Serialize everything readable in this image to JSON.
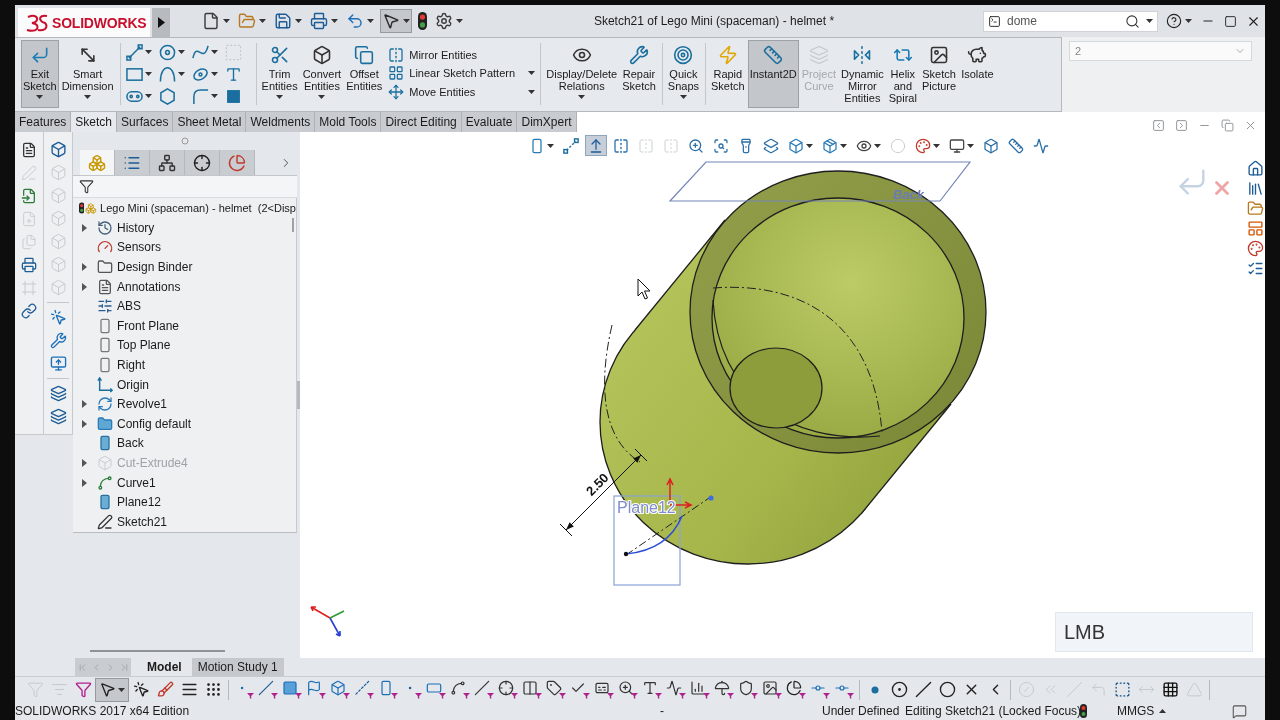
{
  "window": {
    "logo": "SOLIDWORKS",
    "title": "Sketch21 of Lego Mini (spaceman) - helmet *"
  },
  "quick_access": [
    {
      "kind": "new",
      "selected": false,
      "dropdown": true
    },
    {
      "kind": "open",
      "selected": false,
      "dropdown": true
    },
    {
      "kind": "save",
      "selected": false,
      "dropdown": true
    },
    {
      "kind": "print",
      "selected": false,
      "dropdown": true
    },
    {
      "kind": "undo",
      "selected": false,
      "dropdown": true
    },
    {
      "kind": "select",
      "selected": true,
      "dropdown": true
    },
    {
      "kind": "rebuild",
      "selected": false,
      "dropdown": false
    },
    {
      "kind": "options",
      "selected": false,
      "dropdown": true
    }
  ],
  "search": {
    "value": "dome"
  },
  "configuration": {
    "value": "2"
  },
  "command_groups": [
    {
      "items": [
        {
          "kind": "exitsketch",
          "label": "Exit Sketch",
          "selected": true,
          "disabled": false,
          "dropdown": true
        },
        {
          "kind": "dimension",
          "label": "Smart Dimension",
          "selected": false,
          "disabled": false,
          "dropdown": true
        }
      ]
    },
    {
      "items": [
        {
          "kind": "grid",
          "tools": [
            {
              "kind": "line",
              "dropdown": true,
              "disabled": false
            },
            {
              "kind": "circle",
              "dropdown": true,
              "disabled": false
            },
            {
              "kind": "spline",
              "dropdown": true,
              "disabled": false
            },
            {
              "kind": "construction",
              "dropdown": false,
              "disabled": true
            },
            {
              "kind": "rectangle",
              "dropdown": true,
              "disabled": false
            },
            {
              "kind": "arc",
              "dropdown": true,
              "disabled": false
            },
            {
              "kind": "ellipse",
              "dropdown": true,
              "disabled": false
            },
            {
              "kind": "text",
              "dropdown": false,
              "disabled": false
            },
            {
              "kind": "slot",
              "dropdown": true,
              "disabled": false
            },
            {
              "kind": "polygon",
              "dropdown": false,
              "disabled": false
            },
            {
              "kind": "fillet",
              "dropdown": true,
              "disabled": false
            },
            {
              "kind": "point",
              "dropdown": false,
              "disabled": false
            }
          ]
        }
      ]
    },
    {
      "items": [
        {
          "kind": "trim",
          "label": "Trim Entities",
          "selected": false,
          "disabled": false,
          "dropdown": true
        },
        {
          "kind": "convert",
          "label": "Convert Entities",
          "selected": false,
          "disabled": false,
          "dropdown": true
        },
        {
          "kind": "offset",
          "label": "Offset Entities",
          "selected": false,
          "disabled": false,
          "dropdown": false
        },
        {
          "kind": "stack",
          "items": [
            {
              "kind": "mirror",
              "label": "Mirror Entities",
              "dropdown": false
            },
            {
              "kind": "pattern",
              "label": "Linear Sketch Pattern",
              "dropdown": true
            },
            {
              "kind": "move",
              "label": "Move Entities",
              "dropdown": true
            }
          ]
        }
      ]
    },
    {
      "items": [
        {
          "kind": "relations",
          "label": "Display/Delete Relations",
          "selected": false,
          "disabled": false,
          "dropdown": true
        },
        {
          "kind": "repair",
          "label": "Repair Sketch",
          "selected": false,
          "disabled": false,
          "dropdown": false
        }
      ]
    },
    {
      "items": [
        {
          "kind": "snaps",
          "label": "Quick Snaps",
          "selected": false,
          "disabled": false,
          "dropdown": true
        }
      ]
    },
    {
      "items": [
        {
          "kind": "rapid",
          "label": "Rapid Sketch",
          "selected": false,
          "disabled": false,
          "dropdown": false
        },
        {
          "kind": "instant2d",
          "label": "Instant2D",
          "selected": true,
          "disabled": false,
          "dropdown": false
        },
        {
          "kind": "projectcurve",
          "label": "Project Curve",
          "selected": false,
          "disabled": true,
          "dropdown": false
        },
        {
          "kind": "dynamicmirror",
          "label": "Dynamic Mirror Entities",
          "selected": false,
          "disabled": false,
          "dropdown": false
        },
        {
          "kind": "helix",
          "label": "Helix and Spiral",
          "selected": false,
          "disabled": false,
          "dropdown": false
        },
        {
          "kind": "picture",
          "label": "Sketch Picture",
          "selected": false,
          "disabled": false,
          "dropdown": false
        },
        {
          "kind": "isolate",
          "label": "Isolate",
          "selected": false,
          "disabled": false,
          "dropdown": false
        }
      ]
    }
  ],
  "command_tabs": [
    {
      "label": "Features",
      "selected": false
    },
    {
      "label": "Sketch",
      "selected": true
    },
    {
      "label": "Surfaces",
      "selected": false
    },
    {
      "label": "Sheet Metal",
      "selected": false
    },
    {
      "label": "Weldments",
      "selected": false
    },
    {
      "label": "Mold Tools",
      "selected": false
    },
    {
      "label": "Direct Editing",
      "selected": false
    },
    {
      "label": "Evaluate",
      "selected": false
    },
    {
      "label": "DimXpert",
      "selected": false
    }
  ],
  "heads_up_toolbar": [
    {
      "kind": "viewsketch",
      "disabled": false,
      "selected": false,
      "dropdown": true
    },
    {
      "kind": "dashline",
      "disabled": false,
      "selected": false,
      "dropdown": false
    },
    {
      "kind": "normal",
      "disabled": false,
      "selected": true,
      "dropdown": false
    },
    {
      "kind": "mirrorview",
      "disabled": false,
      "selected": false,
      "dropdown": false
    },
    {
      "kind": "mirrorview",
      "disabled": true,
      "selected": false,
      "dropdown": false
    },
    {
      "kind": "mirrorview",
      "disabled": true,
      "selected": false,
      "dropdown": false
    },
    {
      "kind": "zoomfit",
      "disabled": false,
      "selected": false,
      "dropdown": false
    },
    {
      "kind": "zoomarea",
      "disabled": false,
      "selected": false,
      "dropdown": false
    },
    {
      "kind": "previous",
      "disabled": false,
      "selected": false,
      "dropdown": false
    },
    {
      "kind": "section",
      "disabled": false,
      "selected": false,
      "dropdown": false
    },
    {
      "kind": "orientation",
      "disabled": false,
      "selected": false,
      "dropdown": true
    },
    {
      "kind": "displaystyle",
      "disabled": false,
      "selected": false,
      "dropdown": true
    },
    {
      "kind": "hide",
      "disabled": false,
      "selected": false,
      "dropdown": true
    },
    {
      "kind": "appearance",
      "disabled": true,
      "selected": false,
      "dropdown": false
    },
    {
      "kind": "scene",
      "disabled": false,
      "selected": false,
      "dropdown": true
    },
    {
      "kind": "viewsettings",
      "disabled": false,
      "selected": false,
      "dropdown": true
    },
    {
      "kind": "cube",
      "disabled": false,
      "selected": false,
      "dropdown": false
    },
    {
      "kind": "measure",
      "disabled": false,
      "selected": false,
      "dropdown": false
    },
    {
      "kind": "rollback",
      "disabled": false,
      "selected": false,
      "dropdown": false
    }
  ],
  "annotation_strip": [
    {
      "kind": "note",
      "disabled": false
    },
    {
      "kind": "editnote",
      "disabled": true
    },
    {
      "kind": "importnote",
      "disabled": false
    },
    {
      "kind": "addnote",
      "disabled": true
    },
    {
      "kind": "stacknote",
      "disabled": true
    },
    {
      "kind": "printnote",
      "disabled": false
    },
    {
      "kind": "framenote",
      "disabled": true
    },
    {
      "kind": "link",
      "disabled": false
    }
  ],
  "view_strip": [
    {
      "kind": "viewcube",
      "disabled": false
    },
    {
      "kind": "viewcube",
      "disabled": true
    },
    {
      "kind": "viewcube",
      "disabled": true
    },
    {
      "kind": "viewcube",
      "disabled": true
    },
    {
      "kind": "viewcube",
      "disabled": true
    },
    {
      "kind": "viewcube",
      "disabled": true
    },
    {
      "kind": "viewcube",
      "disabled": true
    },
    {
      "kind": "separator"
    },
    {
      "kind": "sketchpointer",
      "disabled": false
    },
    {
      "kind": "sketchwrench",
      "disabled": false
    },
    {
      "kind": "sketchmonitor",
      "disabled": false
    },
    {
      "kind": "separator"
    },
    {
      "kind": "copylayers",
      "disabled": false
    },
    {
      "kind": "copylayers",
      "disabled": false
    }
  ],
  "feature_manager": {
    "tabs": [
      {
        "kind": "features",
        "selected": true
      },
      {
        "kind": "properties",
        "selected": false
      },
      {
        "kind": "configurations",
        "selected": false
      },
      {
        "kind": "dimxpert",
        "selected": false
      },
      {
        "kind": "display",
        "selected": false
      }
    ],
    "root": "Lego Mini (spaceman) - helmet  (2<Disp",
    "items": [
      {
        "label": "History",
        "kind": "history",
        "expandable": true,
        "disabled": false
      },
      {
        "label": "Sensors",
        "kind": "sensors",
        "expandable": false,
        "disabled": false
      },
      {
        "label": "Design Binder",
        "kind": "binder",
        "expandable": true,
        "disabled": false
      },
      {
        "label": "Annotations",
        "kind": "annotations",
        "expandable": true,
        "disabled": false
      },
      {
        "label": "ABS",
        "kind": "material",
        "expandable": false,
        "disabled": false
      },
      {
        "label": "Front Plane",
        "kind": "refplane",
        "expandable": false,
        "disabled": false
      },
      {
        "label": "Top Plane",
        "kind": "refplane",
        "expandable": false,
        "disabled": false
      },
      {
        "label": "Right",
        "kind": "refplane",
        "expandable": false,
        "disabled": false
      },
      {
        "label": "Origin",
        "kind": "origin",
        "expandable": false,
        "disabled": false
      },
      {
        "label": "Revolve1",
        "kind": "revolve",
        "expandable": true,
        "disabled": false
      },
      {
        "label": "Config default",
        "kind": "folder",
        "expandable": true,
        "disabled": false
      },
      {
        "label": "Back",
        "kind": "plane",
        "expandable": false,
        "disabled": false
      },
      {
        "label": "Cut-Extrude4",
        "kind": "cut",
        "expandable": true,
        "disabled": true
      },
      {
        "label": "Curve1",
        "kind": "curve",
        "expandable": true,
        "disabled": false
      },
      {
        "label": "Plane12",
        "kind": "plane",
        "expandable": false,
        "disabled": false
      },
      {
        "label": "Sketch21",
        "kind": "sketch",
        "expandable": false,
        "disabled": false
      }
    ]
  },
  "graphics": {
    "plane_label": "Back",
    "dimension": "2.50",
    "sketch_plane_label": "Plane12",
    "overlay": "LMB"
  },
  "task_pane": [
    {
      "kind": "home"
    },
    {
      "kind": "library"
    },
    {
      "kind": "explorer"
    },
    {
      "kind": "panel"
    },
    {
      "kind": "appearances"
    },
    {
      "kind": "customprops"
    }
  ],
  "bottom_tabs": [
    {
      "label": "Model",
      "selected": true
    },
    {
      "label": "Motion Study 1",
      "selected": false
    }
  ],
  "selection_toolbar": {
    "tools": [
      {
        "kind": "funnel",
        "disabled": true,
        "selected": false,
        "dropdown": false
      },
      {
        "kind": "funnels",
        "disabled": true,
        "selected": false,
        "dropdown": false
      },
      {
        "kind": "funnelcolor",
        "disabled": false,
        "selected": false,
        "dropdown": false
      },
      {
        "kind": "pointer",
        "disabled": false,
        "selected": true,
        "dropdown": true
      },
      {
        "kind": "pointerselect",
        "disabled": false,
        "selected": false,
        "dropdown": false
      },
      {
        "kind": "pen",
        "disabled": false,
        "selected": false,
        "dropdown": false
      },
      {
        "kind": "lines",
        "disabled": false,
        "selected": false,
        "dropdown": false
      },
      {
        "kind": "dashes",
        "disabled": false,
        "selected": false,
        "dropdown": false
      }
    ],
    "filters": [
      {
        "kind": "fpoint"
      },
      {
        "kind": "fedge"
      },
      {
        "kind": "fface"
      },
      {
        "kind": "fsurface"
      },
      {
        "kind": "fsolid"
      },
      {
        "kind": "faxis"
      },
      {
        "kind": "fplane"
      },
      {
        "kind": "fvertex"
      },
      {
        "kind": "fsketch"
      },
      {
        "kind": "fsegment"
      },
      {
        "kind": "fmidpoint"
      },
      {
        "kind": "fcenter"
      },
      {
        "kind": "fdim"
      },
      {
        "kind": "ftag"
      },
      {
        "kind": "fcheck"
      },
      {
        "kind": "fnote"
      },
      {
        "kind": "fsearch"
      },
      {
        "kind": "ftext"
      },
      {
        "kind": "fweld"
      },
      {
        "kind": "fdatum"
      },
      {
        "kind": "fhole"
      },
      {
        "kind": "fshield"
      },
      {
        "kind": "fimage"
      },
      {
        "kind": "fpie"
      },
      {
        "kind": "fconn"
      },
      {
        "kind": "fconn"
      }
    ],
    "sketch_tools": [
      {
        "kind": "spoint"
      },
      {
        "kind": "scircle"
      },
      {
        "kind": "sline"
      },
      {
        "kind": "scircle2"
      },
      {
        "kind": "scross"
      },
      {
        "kind": "sangle"
      }
    ],
    "relations": [
      {
        "kind": "rtangent",
        "disabled": true
      },
      {
        "kind": "rcoinc",
        "disabled": true
      },
      {
        "kind": "rparallel",
        "disabled": true
      },
      {
        "kind": "rperp",
        "disabled": true
      },
      {
        "kind": "rcorner",
        "disabled": false
      },
      {
        "kind": "rhoriz",
        "disabled": true
      },
      {
        "kind": "rgrid",
        "disabled": false
      },
      {
        "kind": "rangle",
        "disabled": true
      }
    ]
  },
  "status_bar": {
    "edition": "SOLIDWORKS 2017 x64 Edition",
    "coordinates": "-",
    "definition": "Under Defined",
    "mode": "Editing Sketch21 (Locked Focus)",
    "units": "MMGS"
  }
}
